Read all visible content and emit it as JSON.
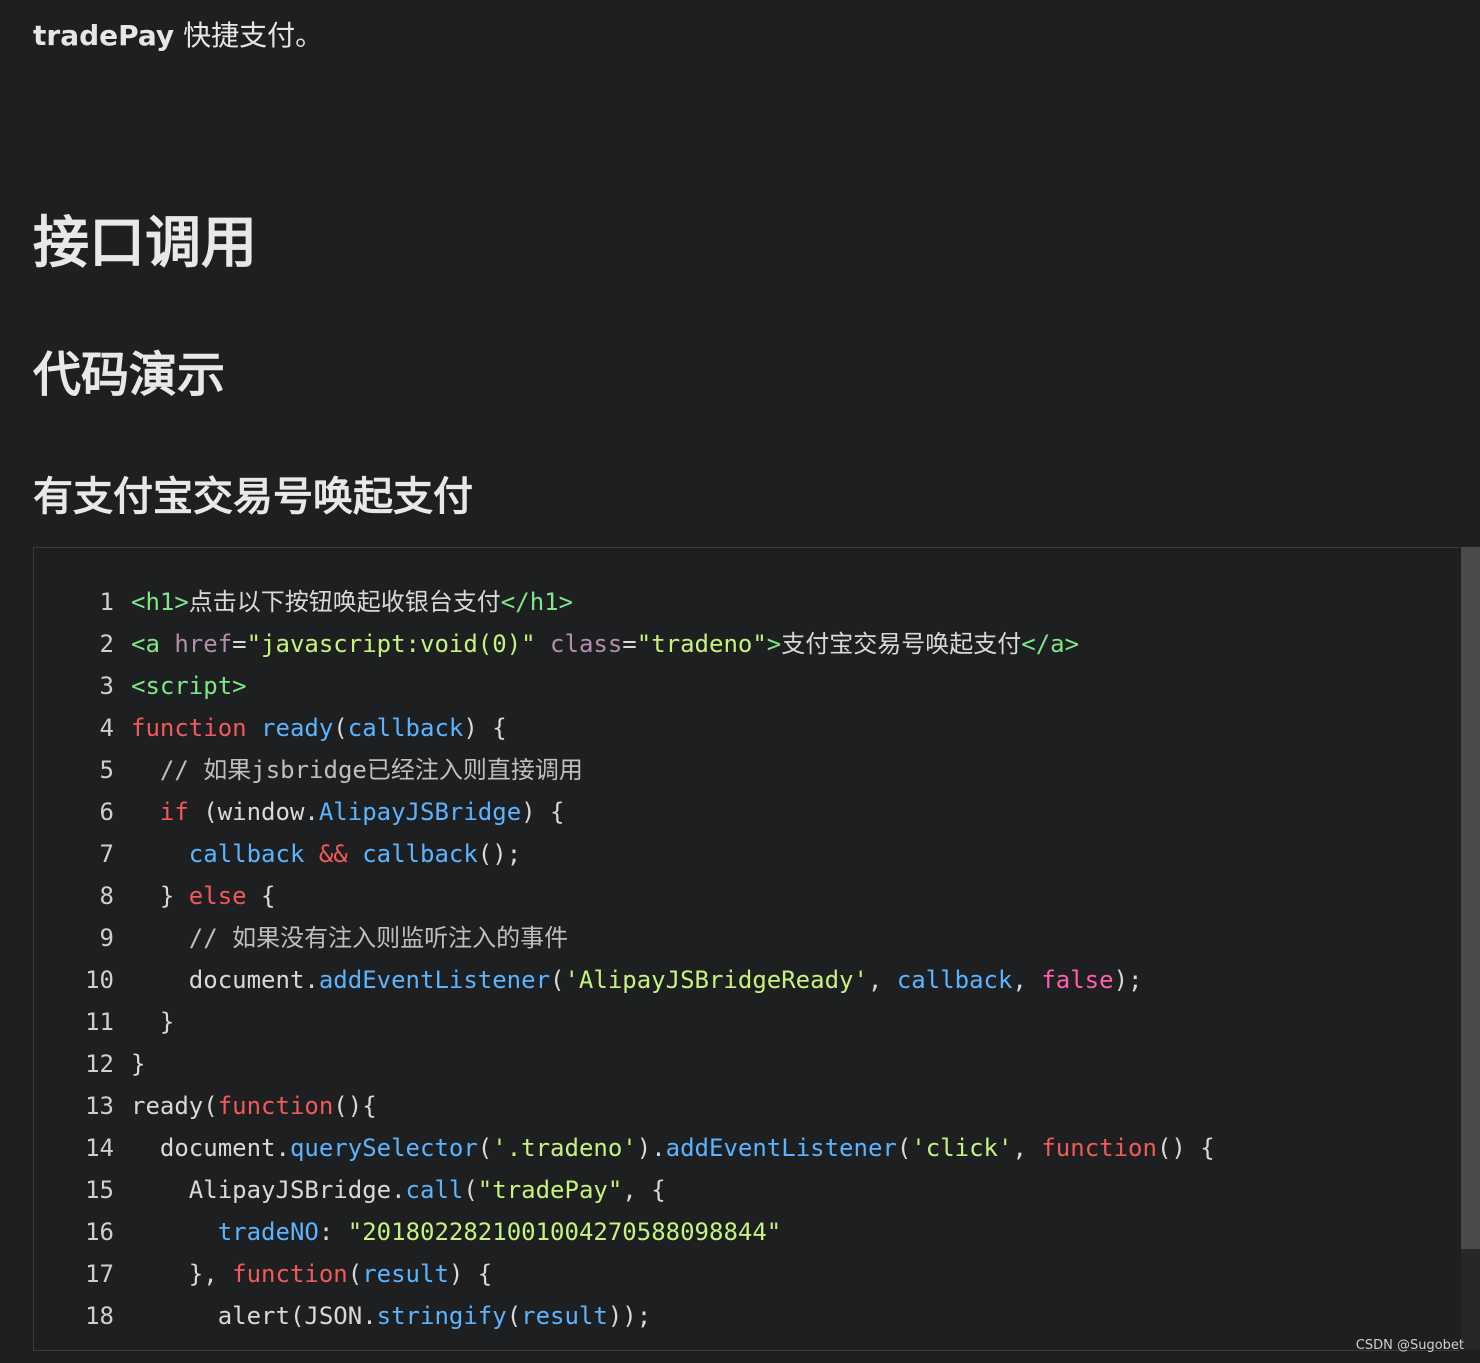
{
  "intro": {
    "bold": "tradePay",
    "rest": " 快捷支付。"
  },
  "headings": {
    "h1": "接口调用",
    "h2": "代码演示",
    "h3": "有支付宝交易号唤起支付"
  },
  "code_lines": [
    {
      "n": "1",
      "segs": [
        [
          "tag",
          "<h1>"
        ],
        [
          "plain",
          "点击以下按钮唤起收银台支付"
        ],
        [
          "tag",
          "</h1>"
        ]
      ]
    },
    {
      "n": "2",
      "segs": [
        [
          "tag",
          "<a "
        ],
        [
          "attr",
          "href"
        ],
        [
          "plain",
          "="
        ],
        [
          "str",
          "\"javascript:void(0)\""
        ],
        [
          "plain",
          " "
        ],
        [
          "attr",
          "class"
        ],
        [
          "plain",
          "="
        ],
        [
          "str",
          "\"tradeno\""
        ],
        [
          "tag",
          ">"
        ],
        [
          "plain",
          "支付宝交易号唤起支付"
        ],
        [
          "tag",
          "</a>"
        ]
      ]
    },
    {
      "n": "3",
      "segs": [
        [
          "tag",
          "<script>"
        ]
      ]
    },
    {
      "n": "4",
      "segs": [
        [
          "kw",
          "function"
        ],
        [
          "plain",
          " "
        ],
        [
          "fn",
          "ready"
        ],
        [
          "plain",
          "("
        ],
        [
          "fn",
          "callback"
        ],
        [
          "plain",
          ") {"
        ]
      ]
    },
    {
      "n": "5",
      "segs": [
        [
          "cm",
          "  // 如果jsbridge已经注入则直接调用"
        ]
      ]
    },
    {
      "n": "6",
      "segs": [
        [
          "plain",
          "  "
        ],
        [
          "kw",
          "if"
        ],
        [
          "plain",
          " (window."
        ],
        [
          "fn",
          "AlipayJSBridge"
        ],
        [
          "plain",
          ") {"
        ]
      ]
    },
    {
      "n": "7",
      "segs": [
        [
          "plain",
          "    "
        ],
        [
          "fn",
          "callback"
        ],
        [
          "plain",
          " "
        ],
        [
          "kw",
          "&&"
        ],
        [
          "plain",
          " "
        ],
        [
          "fn",
          "callback"
        ],
        [
          "plain",
          "();"
        ]
      ]
    },
    {
      "n": "8",
      "segs": [
        [
          "plain",
          "  } "
        ],
        [
          "kw",
          "else"
        ],
        [
          "plain",
          " {"
        ]
      ]
    },
    {
      "n": "9",
      "segs": [
        [
          "cm",
          "    // 如果没有注入则监听注入的事件"
        ]
      ]
    },
    {
      "n": "10",
      "segs": [
        [
          "plain",
          "    document."
        ],
        [
          "fn",
          "addEventListener"
        ],
        [
          "plain",
          "("
        ],
        [
          "str",
          "'AlipayJSBridgeReady'"
        ],
        [
          "plain",
          ", "
        ],
        [
          "fn",
          "callback"
        ],
        [
          "plain",
          ", "
        ],
        [
          "bool",
          "false"
        ],
        [
          "plain",
          ");"
        ]
      ]
    },
    {
      "n": "11",
      "segs": [
        [
          "plain",
          "  }"
        ]
      ]
    },
    {
      "n": "12",
      "segs": [
        [
          "plain",
          "}"
        ]
      ]
    },
    {
      "n": "13",
      "segs": [
        [
          "plain",
          "ready("
        ],
        [
          "kw",
          "function"
        ],
        [
          "plain",
          "(){"
        ]
      ]
    },
    {
      "n": "14",
      "segs": [
        [
          "plain",
          "  document."
        ],
        [
          "fn",
          "querySelector"
        ],
        [
          "plain",
          "("
        ],
        [
          "str",
          "'.tradeno'"
        ],
        [
          "plain",
          ")."
        ],
        [
          "fn",
          "addEventListener"
        ],
        [
          "plain",
          "("
        ],
        [
          "str",
          "'click'"
        ],
        [
          "plain",
          ", "
        ],
        [
          "kw",
          "function"
        ],
        [
          "plain",
          "() {"
        ]
      ]
    },
    {
      "n": "15",
      "segs": [
        [
          "plain",
          "    AlipayJSBridge."
        ],
        [
          "fn",
          "call"
        ],
        [
          "plain",
          "("
        ],
        [
          "str",
          "\"tradePay\""
        ],
        [
          "plain",
          ", {"
        ]
      ]
    },
    {
      "n": "16",
      "segs": [
        [
          "plain",
          "      "
        ],
        [
          "fn",
          "tradeNO"
        ],
        [
          "plain",
          ": "
        ],
        [
          "str",
          "\"2018022821001004270588098844\""
        ]
      ]
    },
    {
      "n": "17",
      "segs": [
        [
          "plain",
          "    }, "
        ],
        [
          "kw",
          "function"
        ],
        [
          "plain",
          "("
        ],
        [
          "fn",
          "result"
        ],
        [
          "plain",
          ") {"
        ]
      ]
    },
    {
      "n": "18",
      "segs": [
        [
          "plain",
          "      alert(JSON."
        ],
        [
          "fn",
          "stringify"
        ],
        [
          "plain",
          "("
        ],
        [
          "fn",
          "result"
        ],
        [
          "plain",
          "));"
        ]
      ]
    }
  ],
  "watermark": "CSDN @Sugobet"
}
